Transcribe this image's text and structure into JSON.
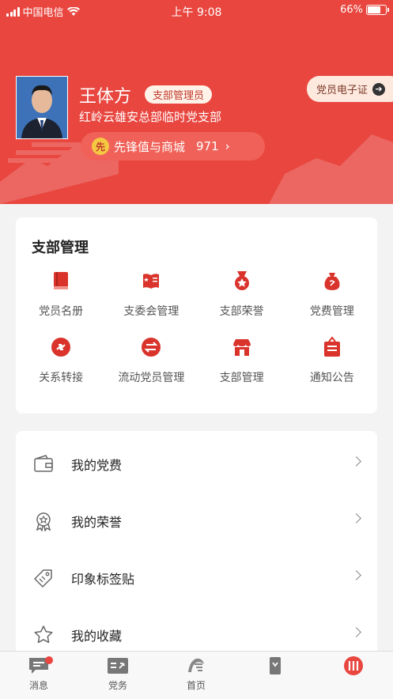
{
  "status_bar": {
    "carrier": "中国电信",
    "time": "上午 9:08",
    "battery": "66%"
  },
  "profile": {
    "name": "王体方",
    "role_badge": "支部管理员",
    "branch": "红岭云雄安总部临时党支部",
    "points_label": "先锋值与商城",
    "points_icon_char": "先",
    "points_value": "971",
    "card_button": "党员电子证"
  },
  "branch_management": {
    "title": "支部管理",
    "items": [
      {
        "label": "党员名册",
        "icon": "book-icon"
      },
      {
        "label": "支委会管理",
        "icon": "flag-book-icon"
      },
      {
        "label": "支部荣誉",
        "icon": "medal-icon"
      },
      {
        "label": "党费管理",
        "icon": "money-bag-icon"
      },
      {
        "label": "关系转接",
        "icon": "transfer-icon"
      },
      {
        "label": "流动党员管理",
        "icon": "swap-icon"
      },
      {
        "label": "支部管理",
        "icon": "storefront-icon"
      },
      {
        "label": "通知公告",
        "icon": "notice-board-icon"
      }
    ]
  },
  "menu": {
    "items": [
      {
        "label": "我的党费",
        "icon": "wallet-icon"
      },
      {
        "label": "我的荣誉",
        "icon": "award-icon"
      },
      {
        "label": "印象标签贴",
        "icon": "tag-icon"
      },
      {
        "label": "我的收藏",
        "icon": "star-icon"
      }
    ]
  },
  "tab_bar": {
    "items": [
      {
        "label": "消息",
        "icon": "message-icon"
      },
      {
        "label": "党务",
        "icon": "party-affairs-icon"
      },
      {
        "label": "首页",
        "icon": "home-logo-icon"
      },
      {
        "label": "",
        "icon": "scroll-icon"
      },
      {
        "label": "",
        "icon": "profile-icon"
      }
    ]
  },
  "colors": {
    "primary": "#e8463f",
    "background": "#f3f3f3"
  }
}
